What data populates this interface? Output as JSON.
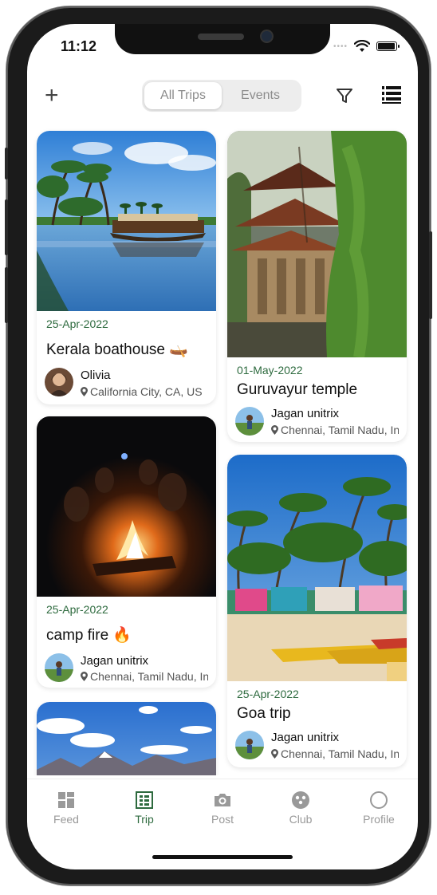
{
  "status": {
    "time": "11:12"
  },
  "header": {
    "add_icon": "plus-icon",
    "tabs": [
      {
        "label": "All Trips",
        "active": true
      },
      {
        "label": "Events",
        "active": false
      }
    ],
    "filter_icon": "filter-icon",
    "menu_icon": "list-icon"
  },
  "feed": {
    "left": [
      {
        "date": "25-Apr-2022",
        "title": "Kerala boathouse 🛶",
        "user": "Olivia",
        "location": "California City, CA, US"
      },
      {
        "date": "25-Apr-2022",
        "title": "camp fire 🔥",
        "user": "Jagan unitrix",
        "location": "Chennai, Tamil Nadu, India"
      }
    ],
    "right": [
      {
        "date": "01-May-2022",
        "title": "Guruvayur temple",
        "user": "Jagan unitrix",
        "location": "Chennai, Tamil Nadu, India"
      },
      {
        "date": "25-Apr-2022",
        "title": "Goa trip",
        "user": "Jagan unitrix",
        "location": "Chennai, Tamil Nadu, India"
      }
    ]
  },
  "tabbar": {
    "items": [
      {
        "label": "Feed",
        "icon": "grid-icon"
      },
      {
        "label": "Trip",
        "icon": "trip-icon",
        "active": true
      },
      {
        "label": "Post",
        "icon": "camera-icon"
      },
      {
        "label": "Club",
        "icon": "club-icon"
      },
      {
        "label": "Profile",
        "icon": "profile-icon"
      }
    ]
  },
  "colors": {
    "accent": "#2d6a3e",
    "muted": "#999999"
  }
}
